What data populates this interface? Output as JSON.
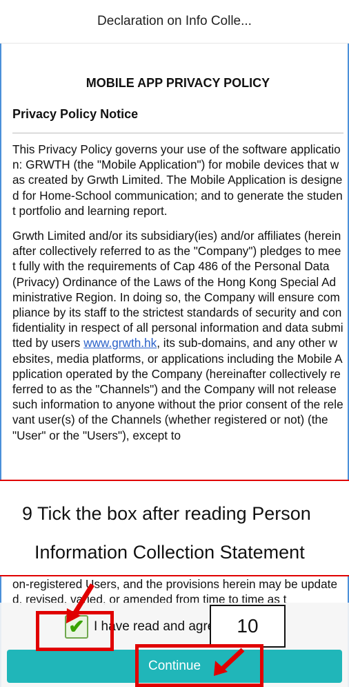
{
  "header": {
    "title": "Declaration on Info Colle..."
  },
  "document": {
    "policy_title": "MOBILE APP PRIVACY POLICY",
    "notice_heading": "Privacy Policy Notice",
    "paragraph1": "This Privacy Policy governs your use of the software application: GRWTH (the \"Mobile Application\") for mobile devices that was created by Grwth Limited. The Mobile Application is designed for Home-School communication; and to generate the student portfolio and learning report.",
    "paragraph2_before_link": "Grwth Limited and/or its subsidiary(ies) and/or affiliates (hereinafter collectively referred to as the \"Company\") pledges to meet fully with the requirements of Cap 486 of the Personal Data (Privacy) Ordinance of the Laws of the Hong Kong Special Administrative Region. In doing so, the Company will ensure compliance by its staff to the strictest standards of security and confidentiality in respect of all personal information and data submitted by users ",
    "paragraph2_link": "www.grwth.hk",
    "paragraph2_after_link": ", its sub-domains, and any other websites, media platforms, or applications including the Mobile Application operated by the Company (hereinafter collectively referred to as the \"Channels\") and the Company will not release such information to anyone without the prior consent of the relevant user(s) of the Channels (whether registered or not) (the \"User\" or the \"Users\"), except to",
    "tail_text": "on-registered Users, and the provisions herein may be updated, revised, varied, or amended from time to time as t"
  },
  "annotation": {
    "step9_line1": "9 Tick the box after reading Person",
    "step9_line2": "Information Collection Statement",
    "step10": "10"
  },
  "footer": {
    "agree_label": "I have read and agree PICS",
    "checkbox_checked": true,
    "checkbox_icon": "check-icon",
    "continue_label": "Continue",
    "accent_color": "#20b6b9",
    "highlight_color": "#e00000"
  }
}
